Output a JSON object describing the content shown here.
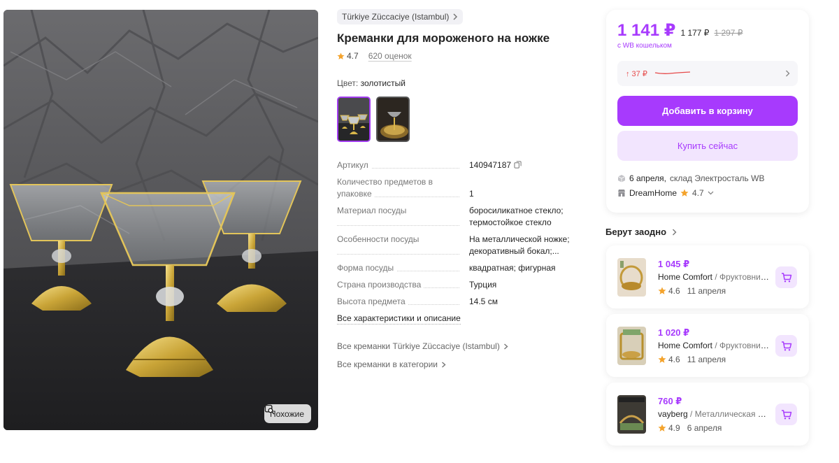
{
  "photo": {
    "similar_label": "Похожие"
  },
  "product": {
    "brand": "Türkiye Züccaciye (Istambul)",
    "title": "Креманки для мороженого на ножке",
    "rating": "4.7",
    "reviews": "620 оценок",
    "color_label": "Цвет:",
    "color_value": "золотистый",
    "specs": [
      {
        "key": "Артикул",
        "value": "140947187"
      },
      {
        "key": "Количество предметов в упаковке",
        "value": "1"
      },
      {
        "key": "Материал посуды",
        "value": "боросиликатное стекло; термостойкое стекло"
      },
      {
        "key": "Особенности посуды",
        "value": "На металлической ножке; декоративный бокал;..."
      },
      {
        "key": "Форма посуды",
        "value": "квадратная; фигурная"
      },
      {
        "key": "Страна производства",
        "value": "Турция"
      },
      {
        "key": "Высота предмета",
        "value": "14.5 см"
      }
    ],
    "all_chars_link": "Все характеристики и описание",
    "brand_link": "Все креманки Türkiye Züccaciye (Istambul)",
    "category_link": "Все креманки в категории"
  },
  "buy": {
    "price": "1 141 ₽",
    "price_old1": "1 177 ₽",
    "price_old2": "1 297 ₽",
    "wallet_note": "с WB кошельком",
    "price_change": "↑ 37 ₽",
    "add_to_cart": "Добавить в корзину",
    "buy_now": "Купить сейчас",
    "delivery_date": "6 апреля,",
    "delivery_warehouse": "склад Электросталь WB",
    "seller_name": "DreamHome",
    "seller_rating": "4.7"
  },
  "also": {
    "title": "Берут заодно",
    "items": [
      {
        "price": "1 045 ₽",
        "brand": "Home Comfort",
        "desc": "Фруктовница",
        "rating": "4.6",
        "date": "11 апреля"
      },
      {
        "price": "1 020 ₽",
        "brand": "Home Comfort",
        "desc": "Фруктовница",
        "rating": "4.6",
        "date": "11 апреля"
      },
      {
        "price": "760 ₽",
        "brand": "vayberg",
        "desc": "Металлическая стойка",
        "rating": "4.9",
        "date": "6 апреля"
      }
    ]
  },
  "colors": {
    "accent": "#a73afd",
    "accent_light": "#f2e5fe",
    "price_up": "#e64a4a",
    "star": "#f4a32c"
  }
}
